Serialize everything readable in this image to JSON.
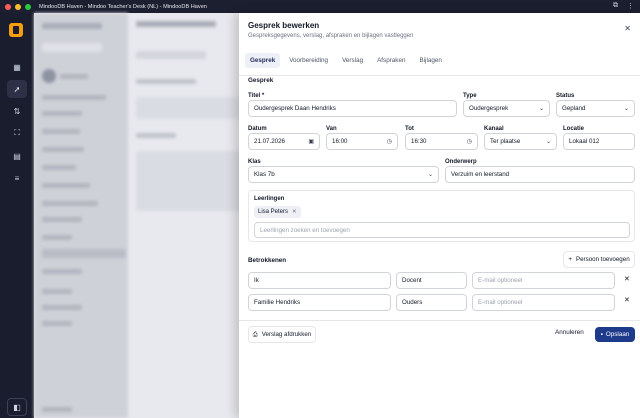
{
  "window": {
    "title": "MindooDB Haven - Mindoo Teacher's Desk (NL) - MindooDB Haven"
  },
  "rail": {
    "icons": [
      "dashboard-icon",
      "rocket-icon",
      "arrows-icon",
      "scan-icon",
      "calendar-icon",
      "sliders-icon",
      "panel-icon"
    ]
  },
  "modal": {
    "title": "Gesprek bewerken",
    "subtitle": "Gespreksgegevens, verslag, afspraken en bijlagen vastleggen",
    "tabs": [
      "Gesprek",
      "Voorbereiding",
      "Verslag",
      "Afspraken",
      "Bijlagen"
    ],
    "active_tab": "Gesprek",
    "section_gesprek": "Gesprek",
    "fields": {
      "titel_label": "Titel *",
      "titel_value": "Oudergesprek Daan Hendriks",
      "type_label": "Type",
      "type_value": "Oudergesprek",
      "status_label": "Status",
      "status_value": "Gepland",
      "datum_label": "Datum",
      "datum_value": "21.07.2026",
      "van_label": "Van",
      "van_value": "16:00",
      "tot_label": "Tot",
      "tot_value": "16:30",
      "kanaal_label": "Kanaal",
      "kanaal_value": "Ter plaatse",
      "locatie_label": "Locatie",
      "locatie_value": "Lokaal 012",
      "klas_label": "Klas",
      "klas_value": "Klas 7b",
      "onderwerp_label": "Onderwerp",
      "onderwerp_value": "Verzuim en leerstand"
    },
    "leerlingen": {
      "label": "Leerlingen",
      "chips": [
        "Lisa Peters"
      ],
      "search_placeholder": "Leerlingen zoeken en toevoegen"
    },
    "betrokkenen": {
      "label": "Betrokkenen",
      "add_button": "Persoon toevoegen",
      "rows": [
        {
          "name": "Ik",
          "role": "Docent",
          "email_placeholder": "E-mail optioneel"
        },
        {
          "name": "Familie Hendriks",
          "role": "Ouders",
          "email_placeholder": "E-mail optioneel"
        }
      ]
    },
    "footer": {
      "print_button": "Verslag afdrukken",
      "cancel_button": "Annuleren",
      "save_button": "Opslaan"
    }
  },
  "colors": {
    "primary": "#1e3a8a",
    "rail_bg": "#1a1d2e"
  }
}
